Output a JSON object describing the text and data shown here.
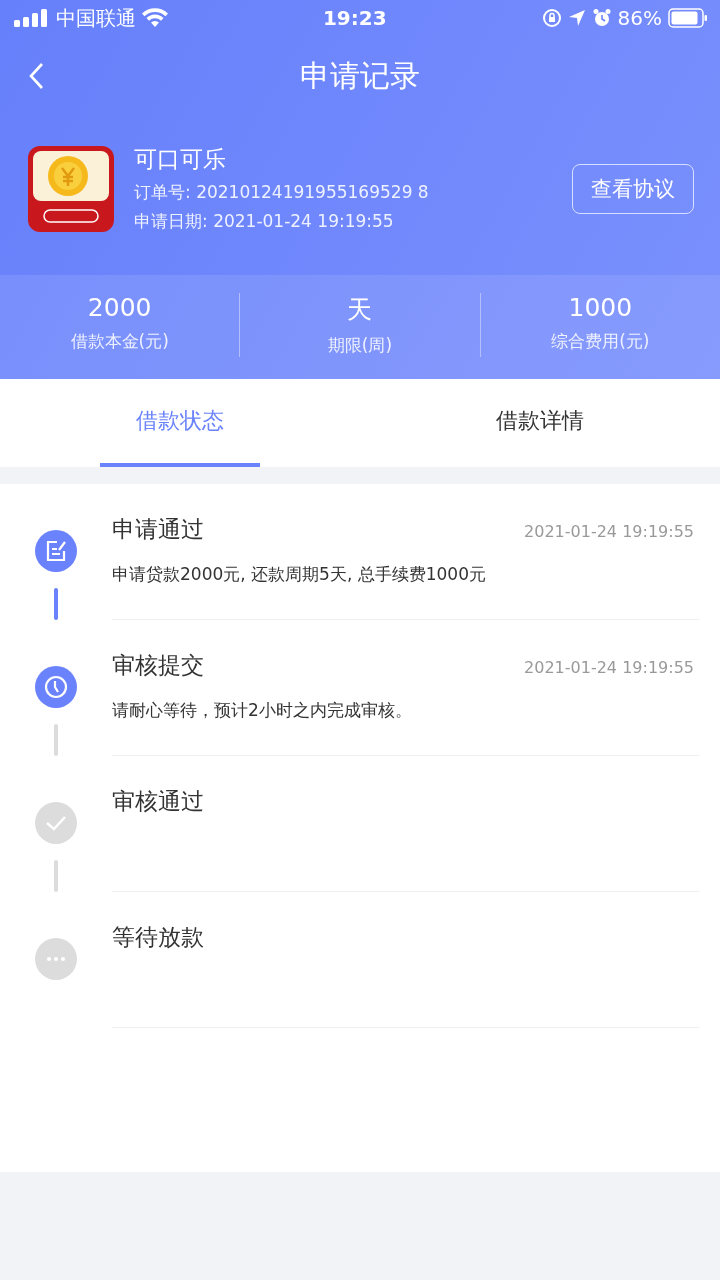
{
  "status_bar": {
    "carrier": "中国联通",
    "time": "19:23",
    "battery": "86%"
  },
  "nav": {
    "title": "申请记录"
  },
  "product": {
    "name": "可口可乐",
    "order_no": "订单号: 20210124191955169529 8",
    "date": "申请日期: 2021-01-24 19:19:55",
    "button": "查看协议"
  },
  "stats": [
    {
      "value": "2000",
      "label": "借款本金(元)"
    },
    {
      "value": "天",
      "label": "期限(周)"
    },
    {
      "value": "1000",
      "label": "综合费用(元)"
    }
  ],
  "tabs": [
    {
      "label": "借款状态",
      "selected": true
    },
    {
      "label": "借款详情",
      "selected": false
    }
  ],
  "steps": [
    {
      "kind": "edit",
      "done": true,
      "title": "申请通过",
      "time": "2021-01-24 19:19:55",
      "desc": "申请贷款2000元, 还款周期5天, 总手续费1000元"
    },
    {
      "kind": "clock",
      "done": true,
      "title": "审核提交",
      "time": "2021-01-24 19:19:55",
      "desc": "请耐心等待，预计2小时之内完成审核。"
    },
    {
      "kind": "check",
      "done": false,
      "title": "审核通过"
    },
    {
      "kind": "more",
      "done": false,
      "title": "等待放款"
    }
  ]
}
